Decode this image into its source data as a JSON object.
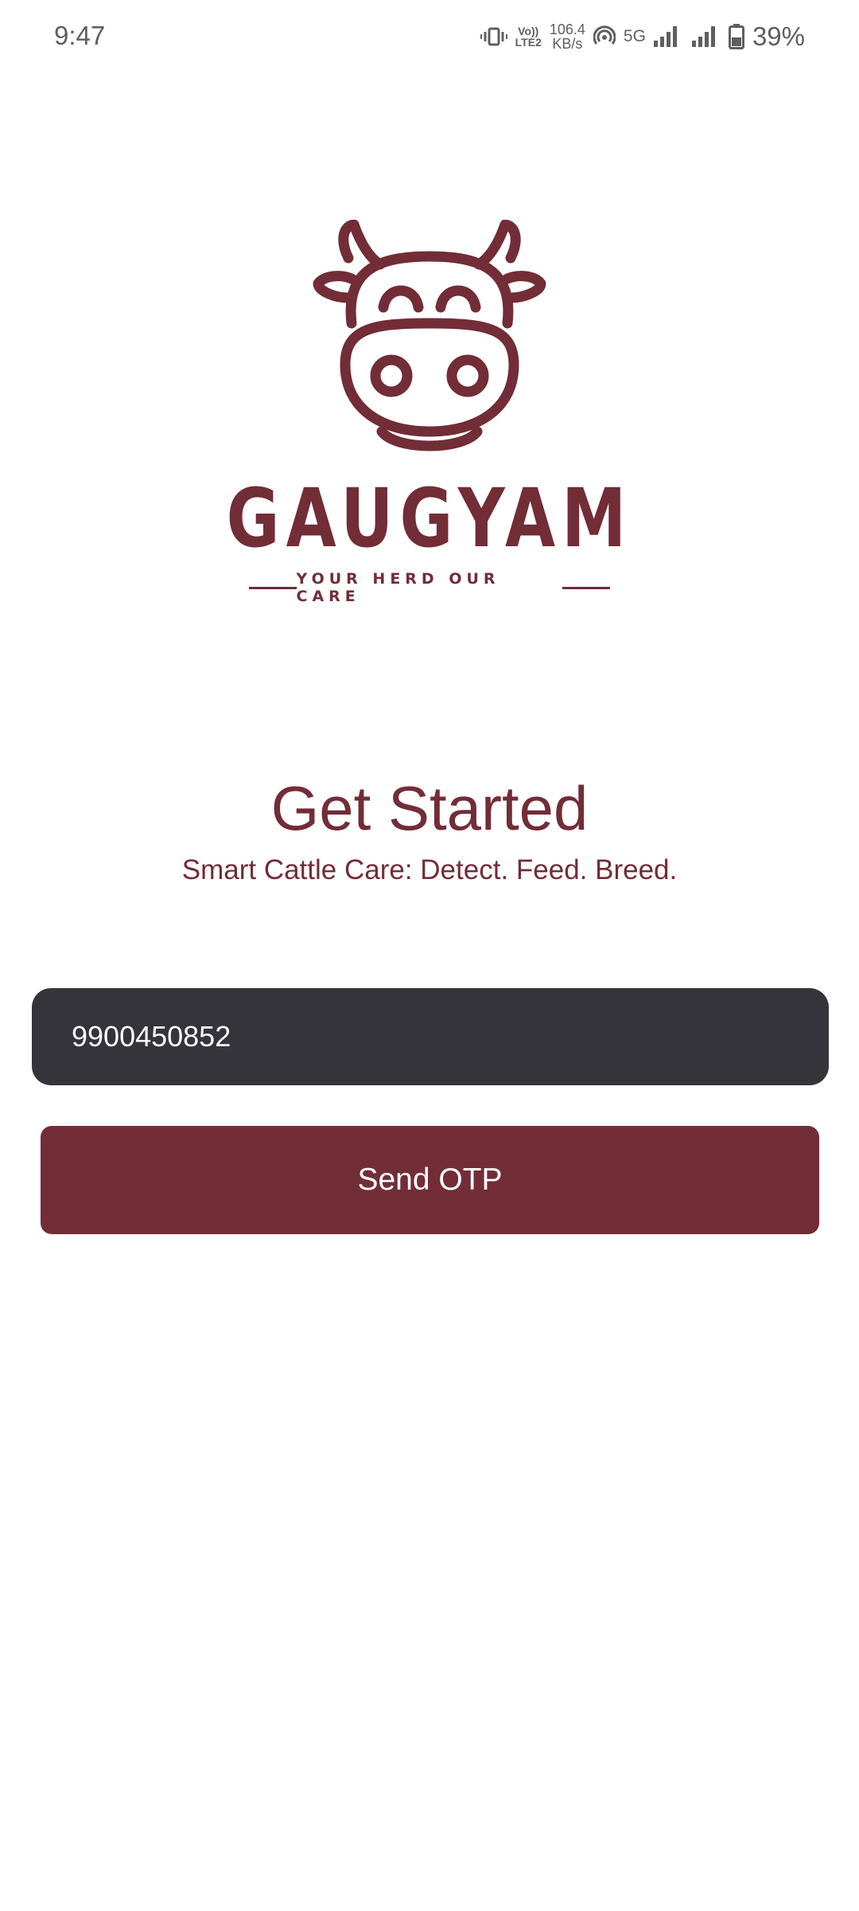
{
  "status_bar": {
    "time": "9:47",
    "volte_line1": "Vo))",
    "volte_line2": "LTE2",
    "speed_value": "106.4",
    "speed_unit": "KB/s",
    "network": "5G",
    "battery": "39%"
  },
  "brand": {
    "name": "GAUGYAM",
    "tagline": "YOUR HERD OUR CARE",
    "color": "#722d37"
  },
  "main": {
    "title": "Get Started",
    "subtitle": "Smart Cattle Care: Detect. Feed. Breed."
  },
  "form": {
    "phone_value": "9900450852",
    "send_label": "Send OTP",
    "input_bg": "#35343b",
    "button_bg": "#722d37"
  }
}
